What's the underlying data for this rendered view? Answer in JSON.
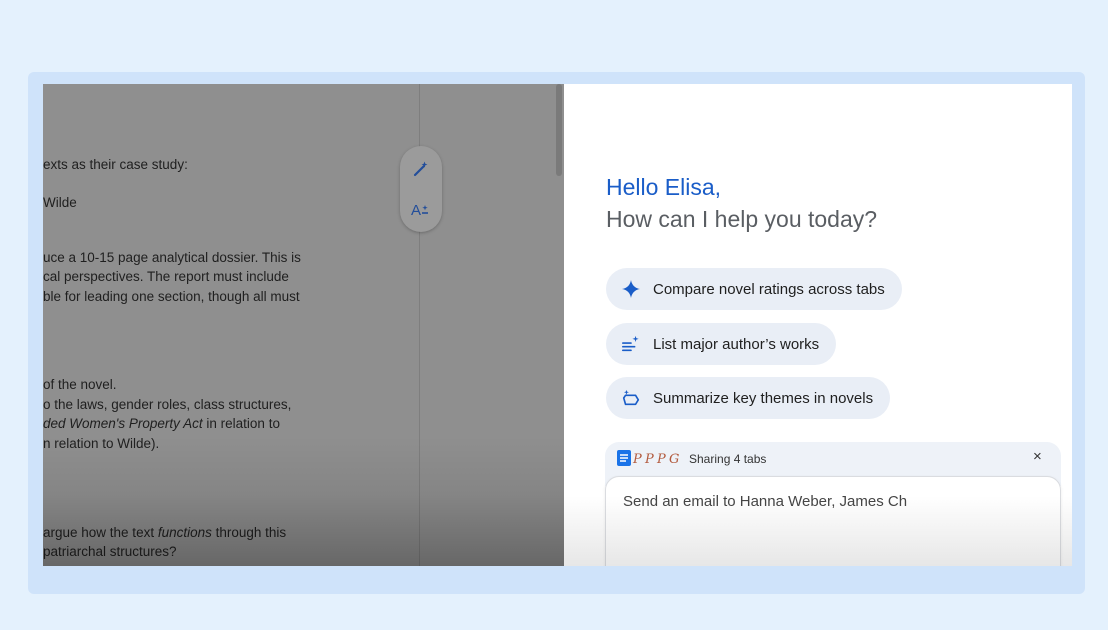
{
  "document": {
    "lines": [
      {
        "text": "exts as their case study:"
      },
      {
        "text": "Wilde"
      },
      {
        "text": "uce a 10-15 page analytical dossier. This is"
      },
      {
        "text": "cal perspectives. The report must include"
      },
      {
        "text": "ble for leading one section, though all must"
      },
      {
        "text": "of the novel."
      },
      {
        "text": "o the laws, gender roles, class structures,"
      },
      {
        "pre": "ded ",
        "italic": "Women's Property Act",
        "post": " in relation to"
      },
      {
        "text": "n relation to Wilde)."
      },
      {
        "pre": " argue how the text ",
        "italic": "functions",
        "post": " through this"
      },
      {
        "text": "patriarchal structures?"
      }
    ],
    "tools": [
      "magic-pen-icon",
      "text-sparkle-icon"
    ]
  },
  "panel": {
    "greeting_name": "Hello Elisa,",
    "greeting_question": "How can I help you today?",
    "suggestions": [
      {
        "icon": "sparkle-icon",
        "label": "Compare novel ratings across tabs"
      },
      {
        "icon": "list-sparkle-icon",
        "label": "List major author’s works"
      },
      {
        "icon": "summarize-icon",
        "label": "Summarize key themes in novels"
      }
    ],
    "sharing": {
      "label": "Sharing 4 tabs",
      "favicons": [
        "P",
        "P",
        "P",
        "G"
      ],
      "close": "×"
    },
    "composer_text": "Send an email to Hanna Weber, James Ch"
  },
  "colors": {
    "accent": "#1a5dc8",
    "chip_bg": "#e9eef6",
    "page_bg": "#e4f1fd"
  }
}
